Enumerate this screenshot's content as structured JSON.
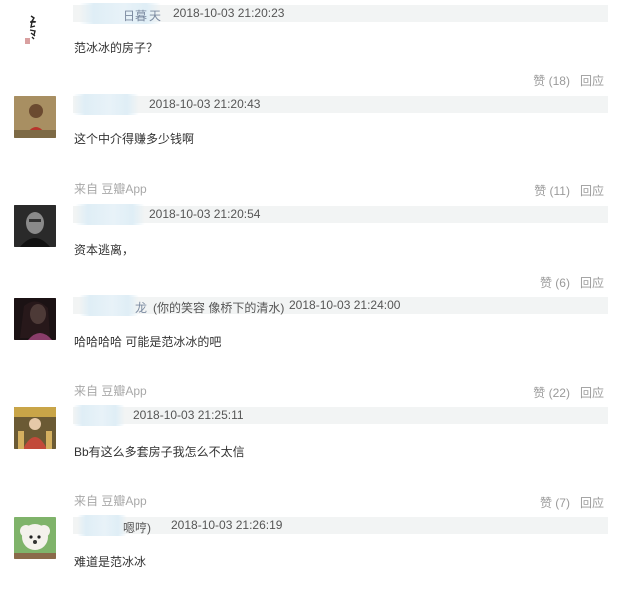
{
  "comments": [
    {
      "name_fragment": "日暮",
      "name_suffix": "天",
      "time": "2018-10-03 21:20:23",
      "text": "范冰冰的房子？",
      "like_label": "赞 (18)",
      "reply_label": "回应",
      "avatar": "calligraphy-seal"
    },
    {
      "name_fragment": "",
      "time": "2018-10-03 21:20:43",
      "text": "这个中介得赚多少钱啊",
      "source": "来自 豆瓣App",
      "like_label": "赞 (11)",
      "reply_label": "回应",
      "avatar": "person-red-scarf"
    },
    {
      "name_fragment": "",
      "time": "2018-10-03 21:20:54",
      "text": "资本逃离，",
      "like_label": "赞 (6)",
      "reply_label": "回应",
      "avatar": "dark-portrait"
    },
    {
      "name_fragment": "龙",
      "name_note": "(你的笑容 像桥下的清水)",
      "time": "2018-10-03 21:24:00",
      "text": "哈哈哈哈 可能是范冰冰的吧",
      "source": "来自 豆瓣App",
      "like_label": "赞 (22)",
      "reply_label": "回应",
      "avatar": "woman-portrait"
    },
    {
      "name_fragment": "",
      "time": "2018-10-03 21:25:11",
      "text": "Bb有这么多套房子我怎么不太信",
      "source": "来自 豆瓣App",
      "like_label": "赞 (7)",
      "reply_label": "回应",
      "avatar": "ornate-figure"
    },
    {
      "name_fragment": "嗯哼)",
      "time": "2018-10-03 21:26:19",
      "text": "难道是范冰冰",
      "avatar": "white-dog"
    }
  ],
  "colors": {
    "meta_bar": "#f2f4f4",
    "blur": "#dfeef6",
    "muted": "#9a9a9a"
  }
}
